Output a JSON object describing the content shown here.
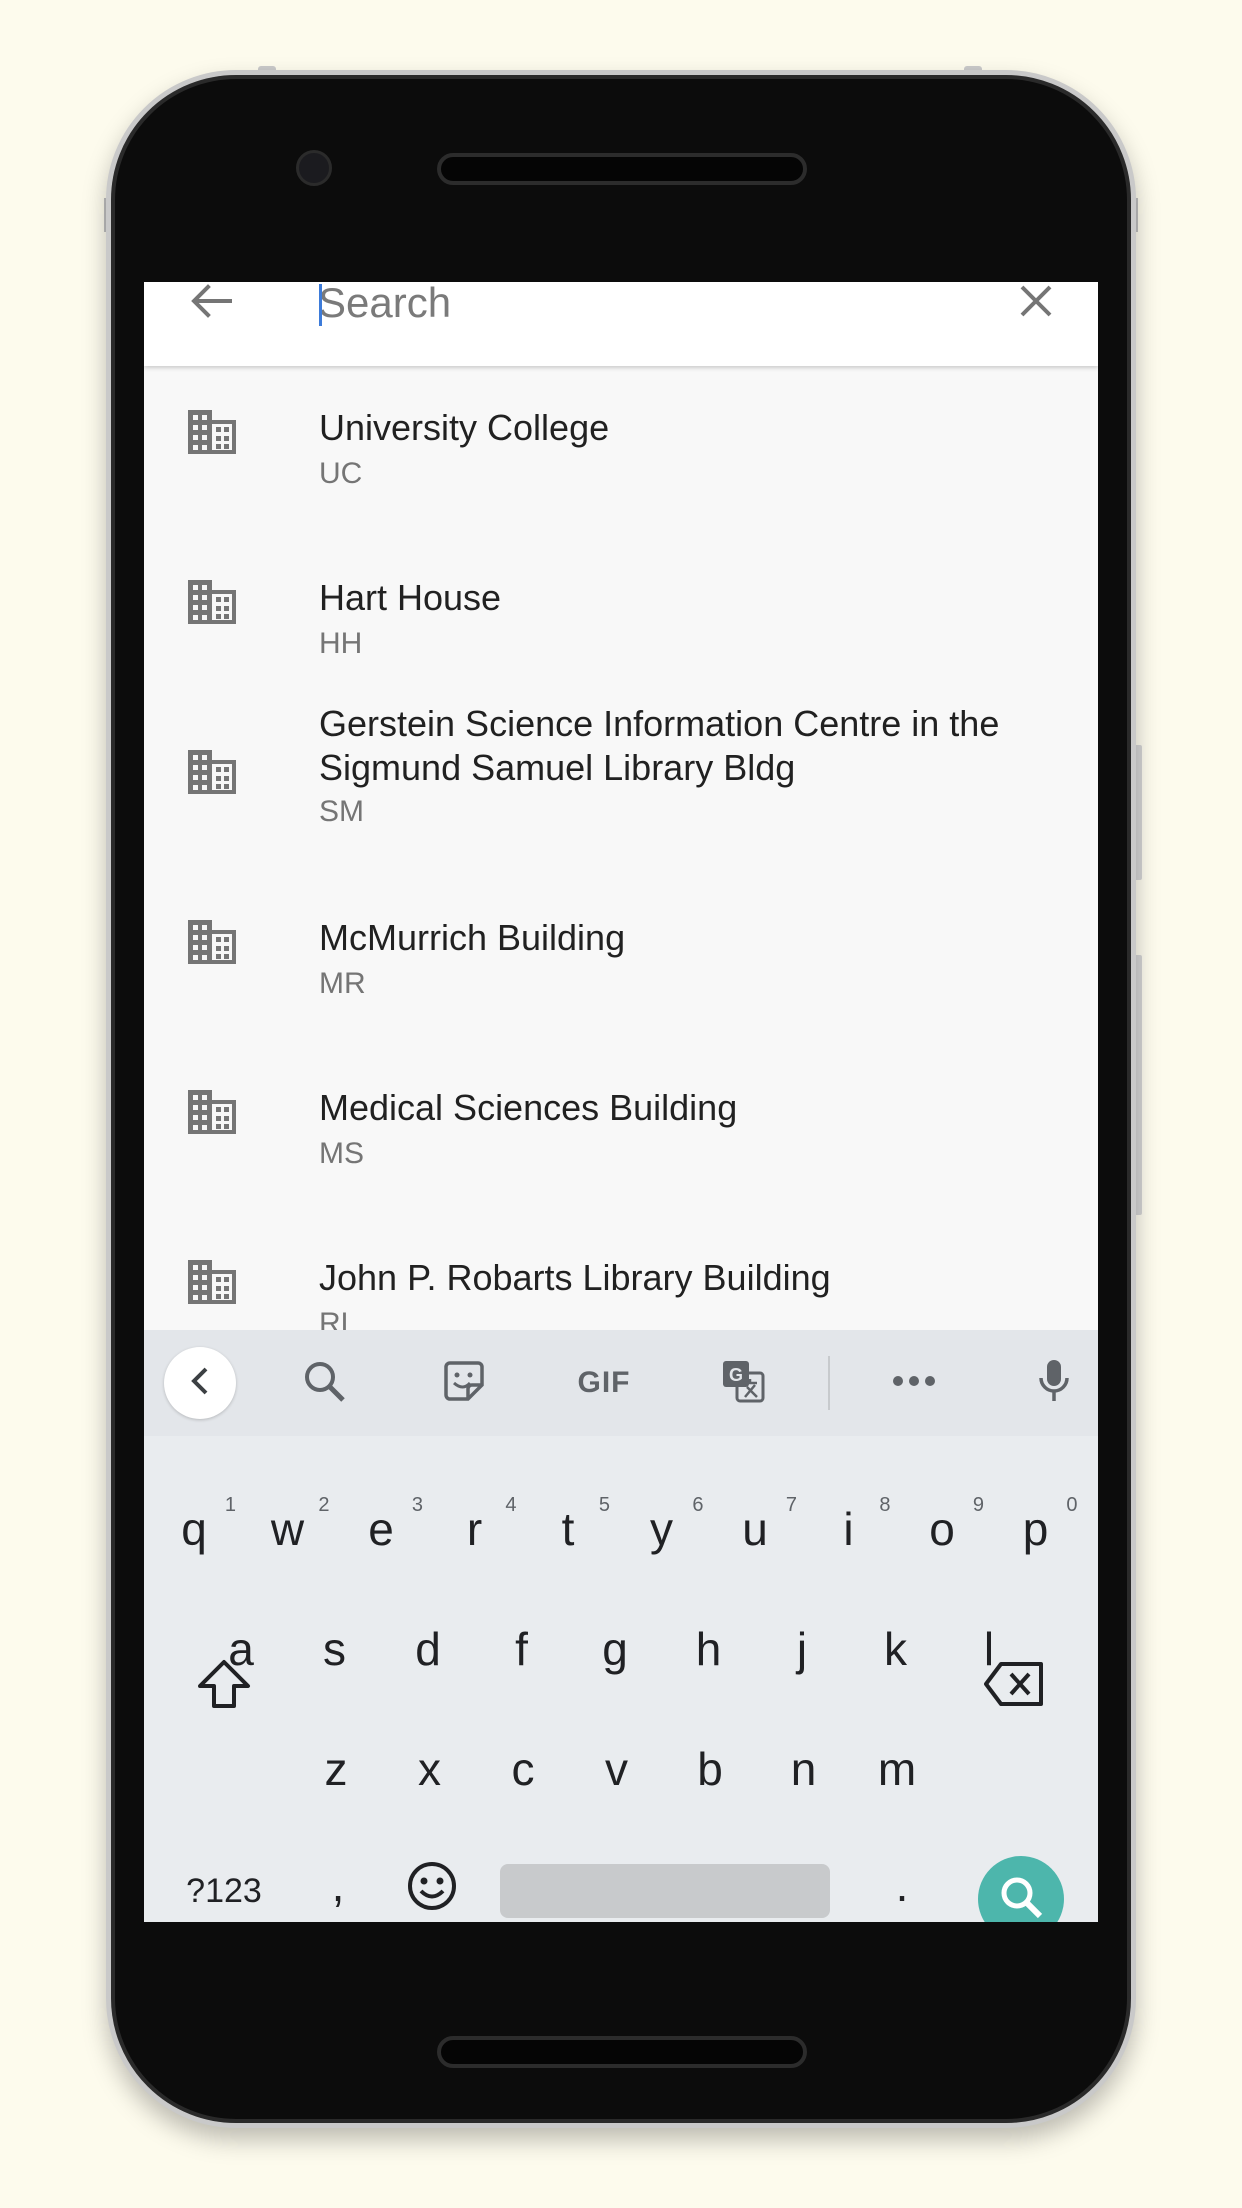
{
  "search": {
    "placeholder": "Search",
    "value": ""
  },
  "results": [
    {
      "name": "University College",
      "code": "UC",
      "icon": "building-icon"
    },
    {
      "name": "Hart House",
      "code": "HH",
      "icon": "building-icon"
    },
    {
      "name": "Gerstein Science Information Centre in the Sigmund Samuel Library Bldg",
      "code": "SM",
      "icon": "building-icon"
    },
    {
      "name": "McMurrich Building",
      "code": "MR",
      "icon": "building-icon"
    },
    {
      "name": "Medical Sciences Building",
      "code": "MS",
      "icon": "building-icon"
    },
    {
      "name": "John P. Robarts Library Building",
      "code": "RL",
      "icon": "building-icon"
    }
  ],
  "keyboard": {
    "toolbar": [
      "collapse-icon",
      "search-icon",
      "sticker-icon",
      "GIF",
      "translate-icon",
      "more-icon",
      "mic-icon"
    ],
    "gif_label": "GIF",
    "row1": [
      {
        "key": "q",
        "hint": "1"
      },
      {
        "key": "w",
        "hint": "2"
      },
      {
        "key": "e",
        "hint": "3"
      },
      {
        "key": "r",
        "hint": "4"
      },
      {
        "key": "t",
        "hint": "5"
      },
      {
        "key": "y",
        "hint": "6"
      },
      {
        "key": "u",
        "hint": "7"
      },
      {
        "key": "i",
        "hint": "8"
      },
      {
        "key": "o",
        "hint": "9"
      },
      {
        "key": "p",
        "hint": "0"
      }
    ],
    "row2": [
      "a",
      "s",
      "d",
      "f",
      "g",
      "h",
      "j",
      "k",
      "l"
    ],
    "row3": [
      "z",
      "x",
      "c",
      "v",
      "b",
      "n",
      "m"
    ],
    "symbols_label": "?123",
    "comma": ",",
    "period": "."
  },
  "colors": {
    "accent": "#4db6ac",
    "caret": "#3d7bd9",
    "background": "#fdfbed"
  }
}
